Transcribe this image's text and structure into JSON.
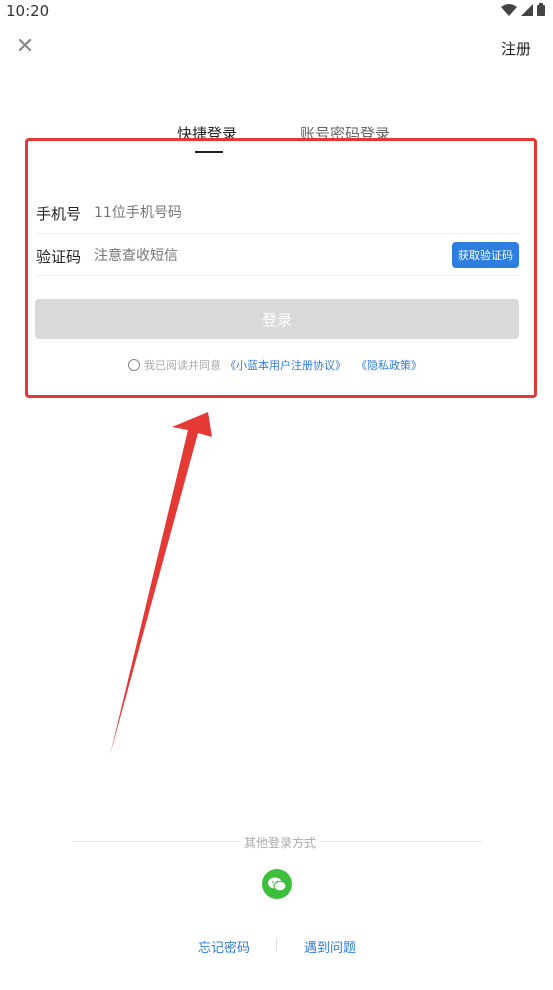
{
  "status_bar": {
    "time": "10:20"
  },
  "header": {
    "close_icon": "close-icon",
    "register_label": "注册"
  },
  "tabs": [
    {
      "label": "快捷登录",
      "active": true
    },
    {
      "label": "账号密码登录",
      "active": false
    }
  ],
  "form": {
    "phone": {
      "label": "手机号",
      "placeholder": "11位手机号码"
    },
    "code": {
      "label": "验证码",
      "placeholder": "注意查收短信",
      "button": "获取验证码"
    },
    "login_button": "登录",
    "agreement": {
      "text": "我已阅读并同意",
      "user_agreement": "《小蓝本用户注册协议》",
      "privacy_policy": "《隐私政策》"
    }
  },
  "other_login": {
    "label": "其他登录方式",
    "icon": "wechat-icon"
  },
  "footer": {
    "forgot_password": "忘记密码",
    "problems": "遇到问题"
  },
  "colors": {
    "accent": "#2e7de1",
    "highlight": "#e53935",
    "wechat": "#3cbf3c",
    "disabled": "#d9d9d9"
  }
}
